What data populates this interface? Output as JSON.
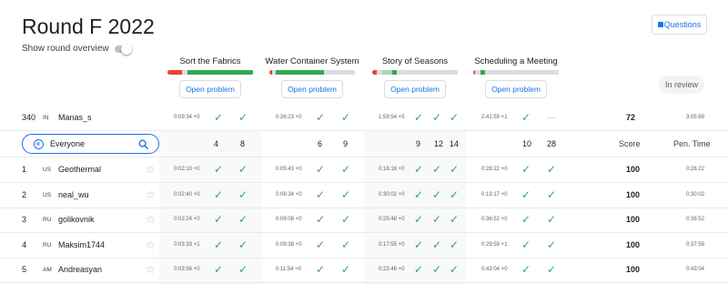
{
  "title": "Round F 2022",
  "show_overview": "Show round overview",
  "questions_label": "Questions",
  "in_review": "In review",
  "open_label": "Open problem",
  "problems": [
    {
      "name": "Sort the Fabrics",
      "bar": [
        [
          "#ea4335",
          0.17
        ],
        [
          "#dadce0",
          0.07
        ],
        [
          "#34a853",
          0.76
        ]
      ]
    },
    {
      "name": "Water Container System",
      "bar": [
        [
          "#ea4335",
          0.04
        ],
        [
          "#dadce0",
          0.04
        ],
        [
          "#34a853",
          0.56
        ],
        [
          "#dadce0",
          0.36
        ]
      ]
    },
    {
      "name": "Story of Seasons",
      "bar": [
        [
          "#ea4335",
          0.06
        ],
        [
          "#dadce0",
          0.06
        ],
        [
          "#a8dab5",
          0.12
        ],
        [
          "#34a853",
          0.05
        ],
        [
          "#dadce0",
          0.71
        ]
      ]
    },
    {
      "name": "Scheduling a Meeting",
      "bar": [
        [
          "#ea4335",
          0.03
        ],
        [
          "#dadce0",
          0.06
        ],
        [
          "#34a853",
          0.05
        ],
        [
          "#dadce0",
          0.86
        ]
      ]
    }
  ],
  "my_row": {
    "rank": "340",
    "country": "IN",
    "name": "Manas_s",
    "cells": [
      "0:09:34 +0",
      "✓",
      "✓",
      "0:26:23 +0",
      "✓",
      "✓",
      "1:59:54 +5",
      "✓",
      "✓",
      "✓",
      "2:41:59 +1",
      "✓",
      "—"
    ],
    "score": "72",
    "pen": "3:05:69"
  },
  "header": {
    "search_value": "Everyone",
    "points": [
      "4",
      "8",
      "6",
      "9",
      "9",
      "12",
      "14",
      "10",
      "28"
    ],
    "score_label": "Score",
    "pen_label": "Pen. Time"
  },
  "rows": [
    {
      "rank": "1",
      "country": "US",
      "name": "Geothermal",
      "cells": [
        "0:02:10 +0",
        "✓",
        "✓",
        "0:05:43 +0",
        "✓",
        "✓",
        "0:16:16 +0",
        "✓",
        "✓",
        "✓",
        "0:28:22 +0",
        "✓",
        "✓"
      ],
      "score": "100",
      "pen": "0:26:22"
    },
    {
      "rank": "2",
      "country": "US",
      "name": "neal_wu",
      "cells": [
        "0:02:40 +0",
        "✓",
        "✓",
        "0:06:34 +0",
        "✓",
        "✓",
        "0:30:02 +0",
        "✓",
        "✓",
        "✓",
        "0:19:17 +0",
        "✓",
        "✓"
      ],
      "score": "100",
      "pen": "0:30:02"
    },
    {
      "rank": "3",
      "country": "RU",
      "name": "golikovnik",
      "cells": [
        "0:02:24 +0",
        "✓",
        "✓",
        "0:09:08 +0",
        "✓",
        "✓",
        "0:25:48 +0",
        "✓",
        "✓",
        "✓",
        "0:36:52 +0",
        "✓",
        "✓"
      ],
      "score": "100",
      "pen": "0:36:52"
    },
    {
      "rank": "4",
      "country": "RU",
      "name": "Maksim1744",
      "cells": [
        "0:03:33 +1",
        "✓",
        "✓",
        "0:09:38 +0",
        "✓",
        "✓",
        "0:17:55 +0",
        "✓",
        "✓",
        "✓",
        "0:29:59 +1",
        "✓",
        "✓"
      ],
      "score": "100",
      "pen": "0:37:59"
    },
    {
      "rank": "5",
      "country": "AM",
      "name": "Andreasyan",
      "cells": [
        "0:03:56 +0",
        "✓",
        "✓",
        "0:11:54 +0",
        "✓",
        "✓",
        "0:23:46 +0",
        "✓",
        "✓",
        "✓",
        "0:43:04 +0",
        "✓",
        "✓"
      ],
      "score": "100",
      "pen": "0:43:04"
    }
  ]
}
